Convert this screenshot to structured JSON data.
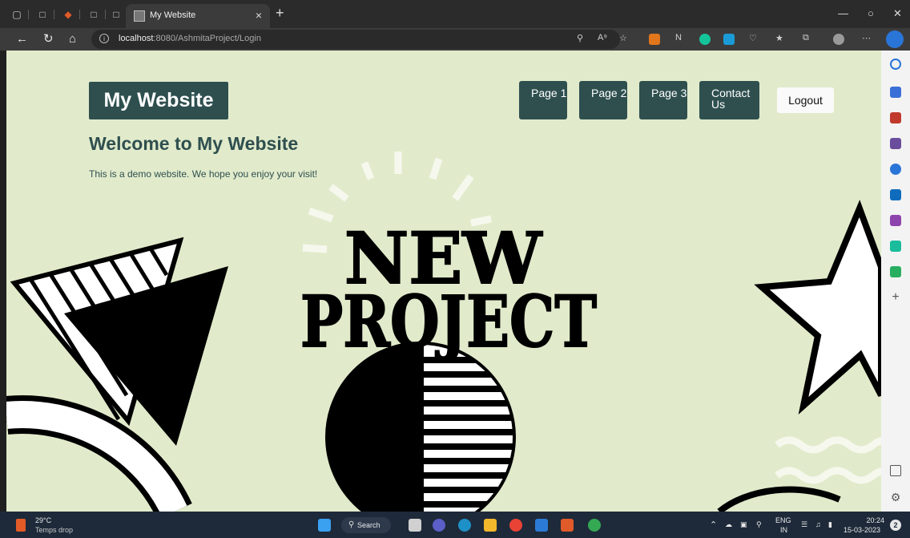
{
  "browser": {
    "tab_title": "My Website",
    "new_tab_label": "+",
    "address": {
      "host": "localhost",
      "rest": ":8080/AshmitaProject/Login"
    },
    "more_label": "⋯"
  },
  "page": {
    "logo": "My Website",
    "nav": [
      {
        "label": "Page 1"
      },
      {
        "label": "Page 2"
      },
      {
        "label": "Page 3"
      },
      {
        "label": "Contact Us"
      }
    ],
    "logout": "Logout",
    "heading": "Welcome to My Website",
    "intro": "This is a demo website. We hope you enjoy your visit!",
    "banner_line1": "NEW",
    "banner_line2": "PROJECT"
  },
  "taskbar": {
    "weather_temp": "29°C",
    "weather_desc": "Temps drop",
    "search_label": "Search",
    "lang_top": "ENG",
    "lang_bottom": "IN",
    "time": "20:24",
    "date": "15-03-2023",
    "notification_count": "2"
  },
  "colors": {
    "page_bg": "#e1ebcb",
    "accent": "#2f4f4f",
    "browser_chrome": "#3b3b3b"
  }
}
